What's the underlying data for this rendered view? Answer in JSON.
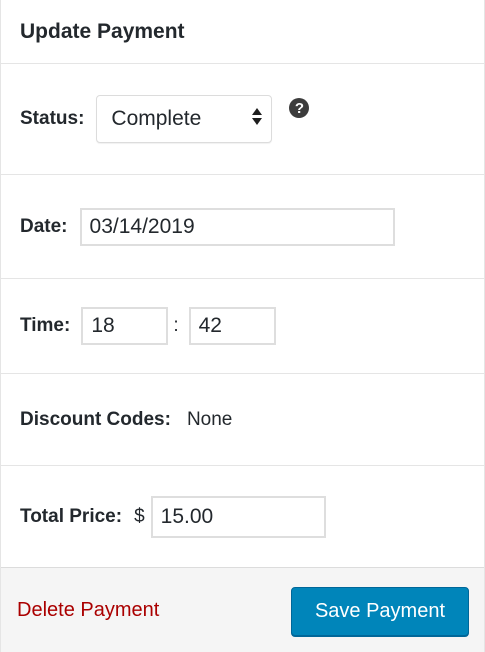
{
  "header": {
    "title": "Update Payment"
  },
  "status": {
    "label": "Status:",
    "selected": "Complete",
    "help_icon": "question-circle-icon",
    "help_glyph": "?"
  },
  "date": {
    "label": "Date:",
    "value": "03/14/2019"
  },
  "time": {
    "label": "Time:",
    "hour": "18",
    "separator": ":",
    "minute": "42"
  },
  "discount": {
    "label": "Discount Codes:",
    "value": "None"
  },
  "total": {
    "label": "Total Price:",
    "currency": "$",
    "value": "15.00"
  },
  "actions": {
    "delete_label": "Delete Payment",
    "save_label": "Save Payment"
  },
  "colors": {
    "accent": "#0085ba",
    "delete": "#aa0000",
    "footer_bg": "#f5f5f5"
  }
}
